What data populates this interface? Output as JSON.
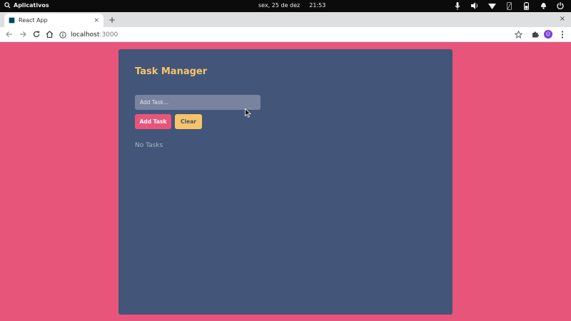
{
  "system_bar": {
    "activities_label": "Aplicativos",
    "date": "sex, 25 de dez",
    "time": "21:53",
    "tray_icons": [
      "microphone-icon",
      "volume-icon",
      "wifi-icon",
      "phone-icon",
      "battery-icon",
      "notification-icon",
      "power-icon"
    ]
  },
  "browser": {
    "tab_title": "React App",
    "new_tab_symbol": "+",
    "close_tab_symbol": "×",
    "window_close_symbol": "×",
    "url_host": "localhost",
    "url_port": ":3000",
    "profile_initial": "☺"
  },
  "app": {
    "title": "Task Manager",
    "input_placeholder": "Add Task...",
    "input_value": "",
    "add_button_label": "Add Task",
    "clear_button_label": "Clear",
    "empty_message": "No Tasks",
    "colors": {
      "background": "#e8557a",
      "card": "#435578",
      "accent": "#f7c46a",
      "input": "#78849f"
    }
  }
}
